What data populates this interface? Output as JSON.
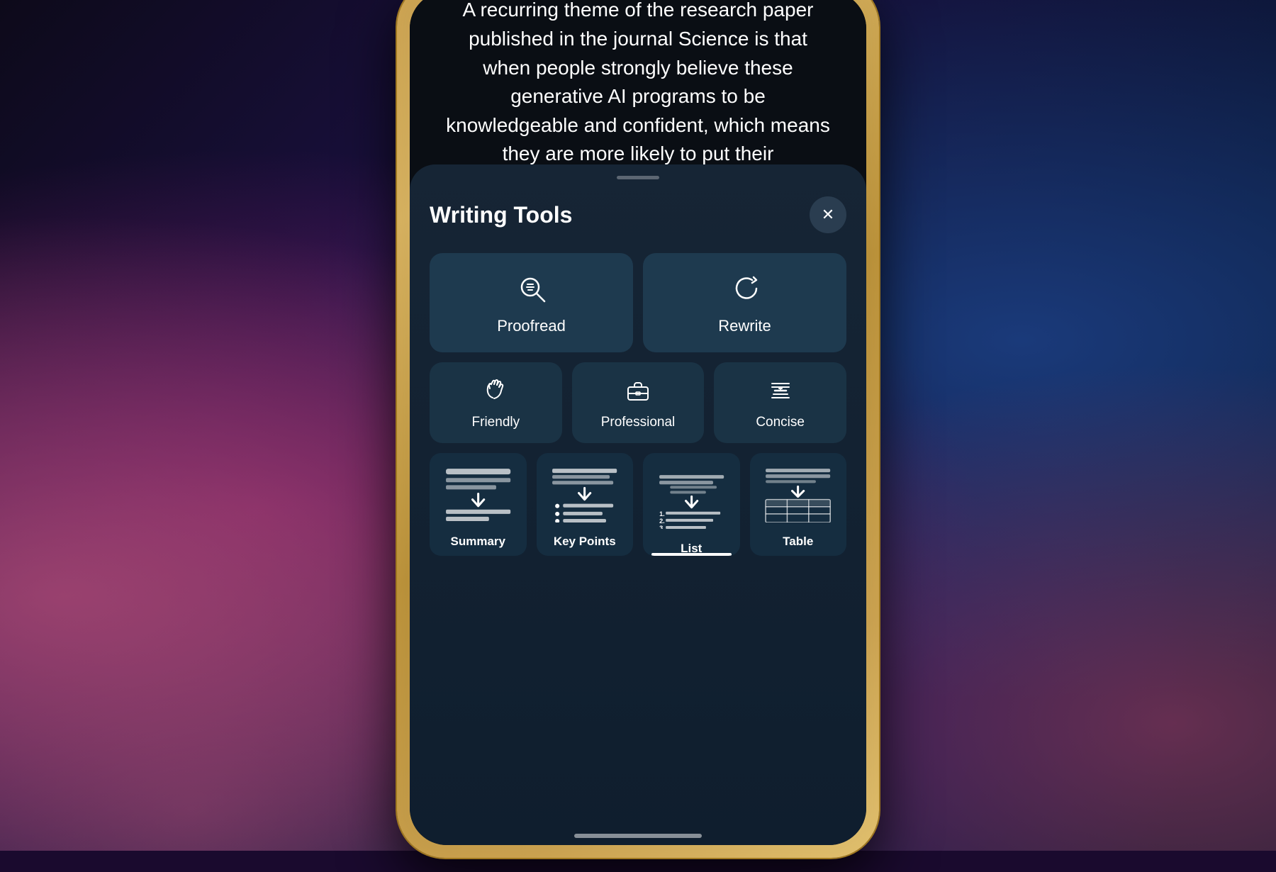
{
  "background": {
    "description": "Dark purple-blue gradient with hand holding phone"
  },
  "article": {
    "text": "A recurring theme of the research paper published in the journal Science is that when people strongly believe these generative AI programs to be knowledgeable and confident, which means they are more likely to put their"
  },
  "writingTools": {
    "title": "Writing Tools",
    "close_label": "✕",
    "tools": {
      "row1": [
        {
          "id": "proofread",
          "label": "Proofread",
          "icon": "proofread-icon"
        },
        {
          "id": "rewrite",
          "label": "Rewrite",
          "icon": "rewrite-icon"
        }
      ],
      "row2": [
        {
          "id": "friendly",
          "label": "Friendly",
          "icon": "friendly-icon"
        },
        {
          "id": "professional",
          "label": "Professional",
          "icon": "professional-icon"
        },
        {
          "id": "concise",
          "label": "Concise",
          "icon": "concise-icon"
        }
      ],
      "row3": [
        {
          "id": "summary",
          "label": "Summary",
          "icon": "summary-icon",
          "active": false
        },
        {
          "id": "key-points",
          "label": "Key Points",
          "icon": "key-points-icon",
          "active": false
        },
        {
          "id": "list",
          "label": "List",
          "icon": "list-icon",
          "active": true
        },
        {
          "id": "table",
          "label": "Table",
          "icon": "table-icon",
          "active": false
        }
      ]
    }
  },
  "colors": {
    "background": "#0a0e14",
    "sheet_bg": "#162535",
    "btn_large": "#1e3a4f",
    "btn_medium": "#1a3345",
    "btn_card": "#152d40",
    "text_primary": "#ffffff",
    "accent": "#ffffff",
    "handle": "rgba(255,255,255,0.3)"
  }
}
